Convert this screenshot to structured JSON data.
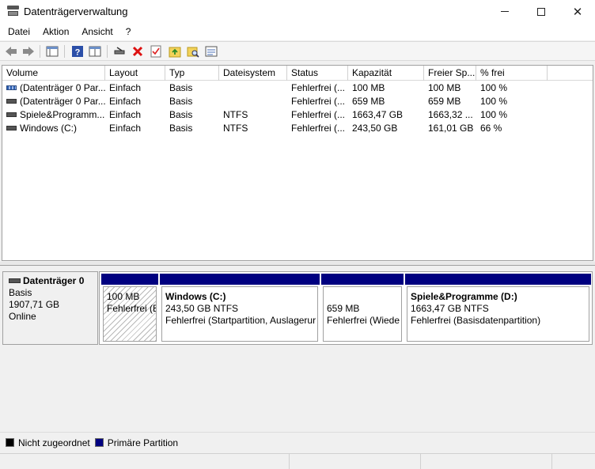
{
  "window": {
    "title": "Datenträgerverwaltung"
  },
  "menu": [
    "Datei",
    "Aktion",
    "Ansicht",
    "?"
  ],
  "toolbar": {
    "icons": [
      "back-arrow-icon",
      "forward-arrow-icon",
      "properties-pane-icon",
      "help-icon",
      "view-pane-icon",
      "connect-icon",
      "delete-icon",
      "checklist-icon",
      "folder-up-icon",
      "folder-search-icon",
      "list-view-icon"
    ]
  },
  "volume_table": {
    "headers": [
      "Volume",
      "Layout",
      "Typ",
      "Dateisystem",
      "Status",
      "Kapazität",
      "Freier Sp...",
      "% frei"
    ],
    "rows": [
      {
        "icon": "striped-disk-icon",
        "volume": "(Datenträger 0 Par...",
        "layout": "Einfach",
        "typ": "Basis",
        "dateisystem": "",
        "status": "Fehlerfrei (...",
        "kapazitaet": "100 MB",
        "frei": "100 MB",
        "prozent": "100 %"
      },
      {
        "icon": "disk-icon",
        "volume": "(Datenträger 0 Par...",
        "layout": "Einfach",
        "typ": "Basis",
        "dateisystem": "",
        "status": "Fehlerfrei (...",
        "kapazitaet": "659 MB",
        "frei": "659 MB",
        "prozent": "100 %"
      },
      {
        "icon": "disk-icon",
        "volume": "Spiele&Programm...",
        "layout": "Einfach",
        "typ": "Basis",
        "dateisystem": "NTFS",
        "status": "Fehlerfrei (...",
        "kapazitaet": "1663,47 GB",
        "frei": "1663,32 ...",
        "prozent": "100 %"
      },
      {
        "icon": "disk-icon",
        "volume": "Windows (C:)",
        "layout": "Einfach",
        "typ": "Basis",
        "dateisystem": "NTFS",
        "status": "Fehlerfrei (...",
        "kapazitaet": "243,50 GB",
        "frei": "161,01 GB",
        "prozent": "66 %"
      }
    ]
  },
  "disk": {
    "name": "Datenträger 0",
    "type": "Basis",
    "size": "1907,71 GB",
    "state": "Online",
    "partitions": [
      {
        "title": "",
        "line1": "100 MB",
        "line2": "Fehlerfrei (E",
        "hatched": true
      },
      {
        "title": "Windows  (C:)",
        "line1": "243,50 GB NTFS",
        "line2": "Fehlerfrei (Startpartition, Auslagerur",
        "hatched": false
      },
      {
        "title": "",
        "line1": "659 MB",
        "line2": "Fehlerfrei (Wiede",
        "hatched": false
      },
      {
        "title": "Spiele&Programme  (D:)",
        "line1": "1663,47 GB NTFS",
        "line2": "Fehlerfrei (Basisdatenpartition)",
        "hatched": false
      }
    ]
  },
  "legend": [
    {
      "label": "Nicht zugeordnet",
      "color": "#000000"
    },
    {
      "label": "Primäre Partition",
      "color": "#000080"
    }
  ]
}
